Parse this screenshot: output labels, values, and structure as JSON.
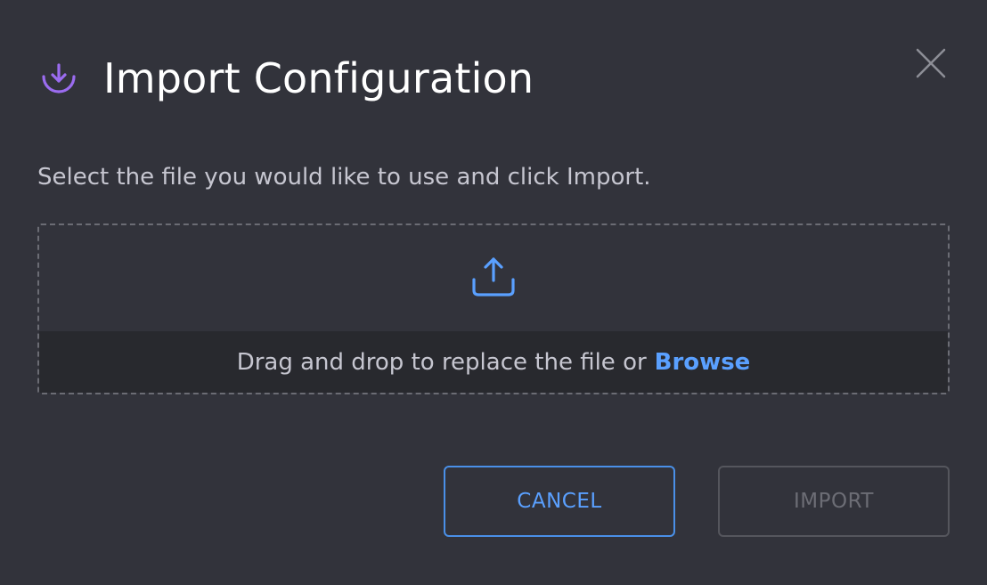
{
  "dialog": {
    "title": "Import Configuration",
    "title_icon": "import-download-icon",
    "close_icon": "close-icon",
    "instructions": "Select the file you would like to use and click Import.",
    "dropzone": {
      "upload_icon": "upload-icon",
      "drop_text": "Drag and drop to replace the file or",
      "browse_label": "Browse"
    },
    "buttons": {
      "cancel_label": "CANCEL",
      "import_label": "IMPORT"
    }
  },
  "colors": {
    "background": "#32333b",
    "accent_purple": "#9b6cf0",
    "accent_blue": "#5aa0ff",
    "disabled": "#6c6d75"
  }
}
